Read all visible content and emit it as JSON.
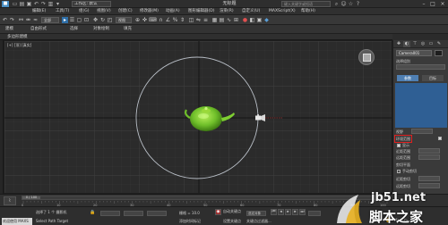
{
  "titlebar": {
    "workspace": "工作区: 默认",
    "title": "无标题",
    "search_placeholder": "键入关键字或短语"
  },
  "menubar": {
    "items": [
      "编辑(E)",
      "工具(T)",
      "组(G)",
      "视图(V)",
      "创建(C)",
      "修改器(M)",
      "动画(A)",
      "图形编辑器(D)",
      "渲染(R)",
      "自定义(U)",
      "MAXScript(X)",
      "帮助(H)"
    ]
  },
  "toolbar": {
    "filter": "全部",
    "ref_coord": "视图"
  },
  "ribbon": {
    "tabs": [
      "建模",
      "自由形式",
      "选择",
      "对象绘制",
      "填充"
    ],
    "sub_label": "多边形建模"
  },
  "viewport": {
    "label": "[+] [顶] [真实]",
    "frame_counter": "0 / 100"
  },
  "command_panel": {
    "object_name": "Camera001",
    "section_label": "选择组别",
    "btn_a": "参数",
    "btn_b": "目标",
    "field_fov_label": "视野",
    "env_label": "环境范围",
    "clip_manual_label": "手动剪切",
    "near_label": "近距",
    "far_label": "远距",
    "show_label": "显示",
    "near_range_label": "近距范围",
    "far_range_label": "远距范围",
    "clip_label": "剪切平面",
    "near_clip_label": "近距剪切",
    "far_clip_label": "远距剪切"
  },
  "timeline": {
    "thumb": "0 / 100",
    "ticks": [
      "0",
      "10",
      "20",
      "30",
      "40",
      "50",
      "60",
      "70",
      "80",
      "90",
      "100"
    ]
  },
  "statusbar": {
    "selection": "选择了 1 个 摄影机",
    "prompt": "Select Path Target",
    "welcome": "欢迎使用 MAXS",
    "grid": "栅格 = 10.0",
    "add_time_tag": "添加时间标记",
    "auto_key": "自动关键点",
    "set_key": "设置关键点",
    "selected_obj": "选定对象",
    "key_filter": "关键点过滤器..."
  },
  "watermark": {
    "top": "jb51.net",
    "bottom": "脚本之家"
  },
  "colors": {
    "accent": "#2f6fa8",
    "viewport_bg": "#2b2b2b",
    "teapot": "#6fbf2a",
    "highlight_box": "#e02020"
  }
}
